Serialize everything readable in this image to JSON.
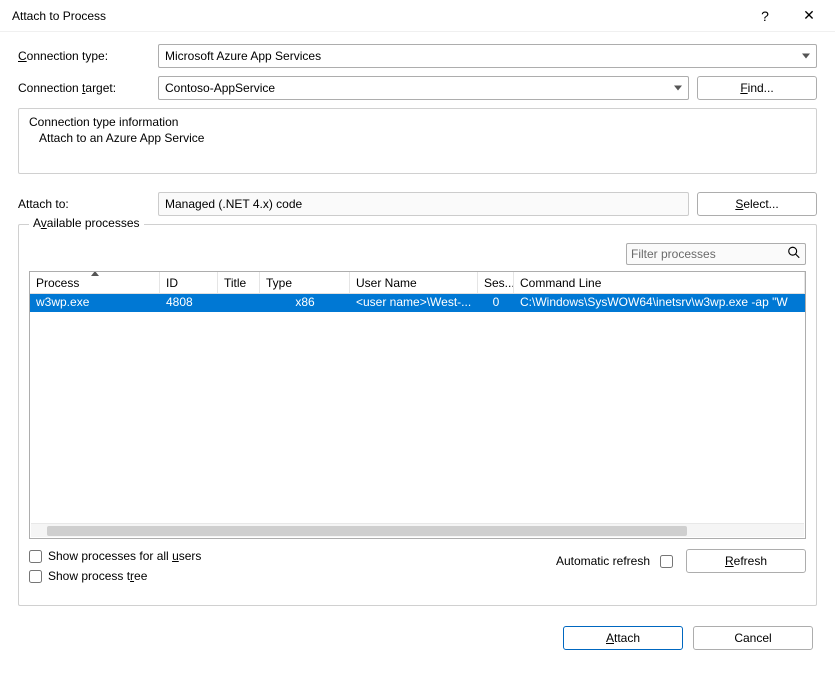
{
  "window": {
    "title": "Attach to Process",
    "help": "?",
    "close": "✕"
  },
  "labels": {
    "connection_type_pre": "C",
    "connection_type_rest": "onnection type:",
    "connection_target_pre": "Connection ",
    "connection_target_ul": "t",
    "connection_target_rest": "arget:",
    "attach_to": "Attach to:",
    "available_processes_pre": "A",
    "available_processes_ul": "v",
    "available_processes_rest": "ailable processes"
  },
  "fields": {
    "connection_type_value": "Microsoft Azure App Services",
    "connection_target_value": "Contoso-AppService",
    "attach_to_value": "Managed (.NET 4.x) code",
    "filter_placeholder": "Filter processes"
  },
  "connection_info": {
    "heading": "Connection type information",
    "line1": "Attach to an Azure App Service"
  },
  "buttons": {
    "find_pre": "F",
    "find_rest": "ind...",
    "select_ul": "S",
    "select_rest": "elect...",
    "refresh_ul": "R",
    "refresh_rest": "efresh",
    "attach_ul": "A",
    "attach_rest": "ttach",
    "cancel": "Cancel"
  },
  "table": {
    "columns": {
      "process": "Process",
      "id": "ID",
      "title": "Title",
      "type": "Type",
      "user": "User Name",
      "session": "Ses...",
      "cmdline": "Command Line"
    },
    "rows": [
      {
        "process": "w3wp.exe",
        "id": "4808",
        "title": "",
        "type": "x86",
        "user": "<user name>\\West-...",
        "session": "0",
        "cmdline": "C:\\Windows\\SysWOW64\\inetsrv\\w3wp.exe -ap \"W"
      }
    ]
  },
  "checks": {
    "all_users_pre": "Show processes for all ",
    "all_users_ul": "u",
    "all_users_rest": "sers",
    "tree_pre": "Show process t",
    "tree_ul": "r",
    "tree_rest": "ee",
    "auto_refresh": "Automatic refresh"
  }
}
